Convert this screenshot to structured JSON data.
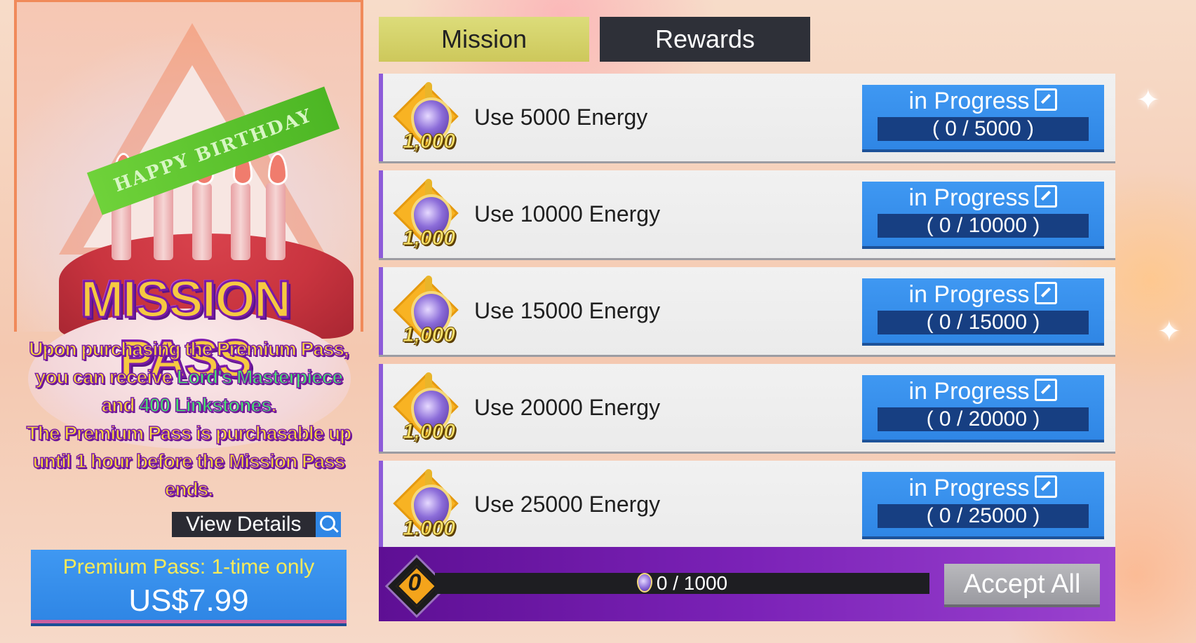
{
  "tabs": [
    {
      "label": "Mission",
      "active": true
    },
    {
      "label": "Rewards",
      "active": false
    }
  ],
  "promo": {
    "banner_art_text": "HAPPY BIRTHDAY",
    "title": "MISSION PASS",
    "desc_1": "Upon purchasing the Premium Pass,",
    "desc_2a": "you can receive ",
    "desc_2b": "Lord's Masterpiece",
    "desc_3a": "and ",
    "desc_3b": "400 Linkstones",
    "desc_3c": ".",
    "desc_4": "The Premium Pass is purchasable up",
    "desc_5": "until 1 hour before the Mission Pass",
    "desc_6": "ends.",
    "view_details": "View Details",
    "buy_line1": "Premium Pass: 1-time only",
    "buy_price": "US$7.99"
  },
  "missions": [
    {
      "label": "Use 5000 Energy",
      "reward": "1,000",
      "status": "in Progress",
      "progress": "( 0 / 5000 )",
      "current": 0,
      "target": 5000
    },
    {
      "label": "Use 10000 Energy",
      "reward": "1,000",
      "status": "in Progress",
      "progress": "( 0 / 10000 )",
      "current": 0,
      "target": 10000
    },
    {
      "label": "Use 15000 Energy",
      "reward": "1,000",
      "status": "in Progress",
      "progress": "( 0 / 15000 )",
      "current": 0,
      "target": 15000
    },
    {
      "label": "Use 20000 Energy",
      "reward": "1,000",
      "status": "in Progress",
      "progress": "( 0 / 20000 )",
      "current": 0,
      "target": 20000
    },
    {
      "label": "Use 25000 Energy",
      "reward": "1.000",
      "status": "in Progress",
      "progress": "( 0 / 25000 )",
      "current": 0,
      "target": 25000
    }
  ],
  "footer": {
    "level": "0",
    "points_text": "0 / 1000",
    "points_fraction": 0,
    "accept_all": "Accept All"
  },
  "colors": {
    "accent_blue": "#2f86e5",
    "progress_bar": "#173f82",
    "footer_purple": "#7b22b7",
    "tab_active": "#cdc85b",
    "tab_inactive": "#2e3038"
  },
  "icons": [
    "search-icon",
    "external-link-icon",
    "energy-gem-icon",
    "level-badge-icon",
    "sparkle-icon"
  ]
}
